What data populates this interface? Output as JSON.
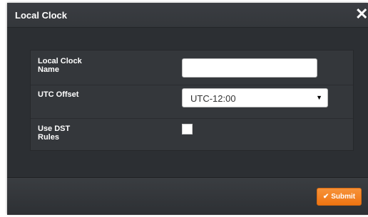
{
  "dialog": {
    "title": "Local Clock",
    "close_glyph": "✕",
    "close_icon": "close-icon"
  },
  "form": {
    "name_label": "Local Clock Name",
    "name_value": "",
    "utc_offset_label": "UTC Offset",
    "utc_offset_value": "UTC-12:00",
    "select_arrow": "▼",
    "dst_label": "Use DST Rules",
    "dst_checked": false
  },
  "footer": {
    "submit_label": "Submit",
    "submit_icon": "check-icon",
    "submit_icon_glyph": "✔",
    "accent_color": "#f0801f"
  }
}
